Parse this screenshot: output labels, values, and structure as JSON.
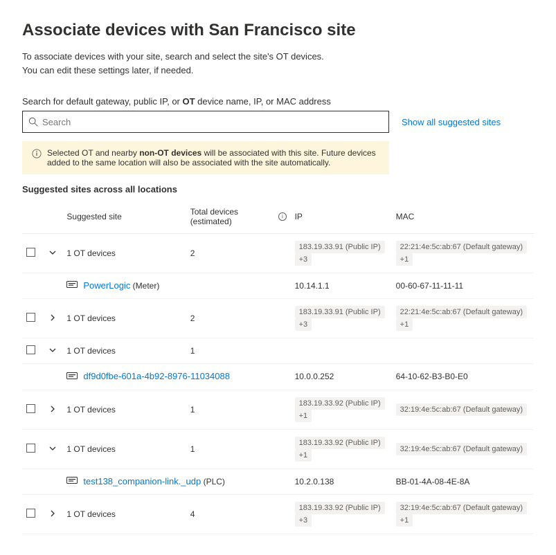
{
  "title": "Associate devices with San Francisco site",
  "desc_line1": "To associate devices with your site, search and select the site's OT devices.",
  "desc_line2": "You can edit these settings later, if needed.",
  "search_label_pre": "Search for default gateway, public IP, or ",
  "search_label_bold": "OT",
  "search_label_post": " device name, IP, or MAC address",
  "search_placeholder": "Search",
  "show_all_link": "Show all suggested sites",
  "banner_pre": "Selected OT and nearby ",
  "banner_bold": "non-OT devices",
  "banner_post": " will be associated with this site. Future devices added to the same location will also be associated with the site automatically.",
  "section_title": "Suggested sites across all locations",
  "columns": {
    "site": "Suggested site",
    "total": "Total devices (estimated)",
    "ip": "IP",
    "mac": "MAC"
  },
  "rows": [
    {
      "type": "group",
      "expanded": true,
      "site": "1 OT devices",
      "total": "2",
      "ip_tag": "183.19.33.91 (Public IP)",
      "ip_cnt": "+3",
      "mac_tag": "22:21:4e:5c:ab:67 (Default gateway)",
      "mac_cnt": "+1"
    },
    {
      "type": "child",
      "name": "PowerLogic",
      "suffix": " (Meter)",
      "ip": "10.14.1.1",
      "mac": "00-60-67-11-11-11"
    },
    {
      "type": "group",
      "expanded": false,
      "site": "1 OT devices",
      "total": "2",
      "ip_tag": "183.19.33.91 (Public IP)",
      "ip_cnt": "+3",
      "mac_tag": "22:21:4e:5c:ab:67 (Default gateway)",
      "mac_cnt": "+1"
    },
    {
      "type": "group",
      "expanded": true,
      "site": "1 OT devices",
      "total": "1",
      "ip_tag": "",
      "ip_cnt": "",
      "mac_tag": "",
      "mac_cnt": ""
    },
    {
      "type": "child",
      "name": "df9d0fbe-601a-4b92-8976-11034088",
      "suffix": "",
      "ip": "10.0.0.252",
      "mac": "64-10-62-B3-B0-E0"
    },
    {
      "type": "group",
      "expanded": false,
      "site": "1 OT devices",
      "total": "1",
      "ip_tag": "183.19.33.92 (Public IP)",
      "ip_cnt": "+1",
      "mac_tag": "32:19:4e:5c:ab:67 (Default gateway)",
      "mac_cnt": ""
    },
    {
      "type": "group",
      "expanded": true,
      "site": "1 OT devices",
      "total": "1",
      "ip_tag": "183.19.33.92 (Public IP)",
      "ip_cnt": "+1",
      "mac_tag": "32:19:4e:5c:ab:67 (Default gateway)",
      "mac_cnt": ""
    },
    {
      "type": "child",
      "name": "test138_companion-link._udp",
      "suffix": " (PLC)",
      "ip": "10.2.0.138",
      "mac": "BB-01-4A-08-4E-8A"
    },
    {
      "type": "group",
      "expanded": false,
      "site": "1 OT devices",
      "total": "4",
      "ip_tag": "183.19.33.92 (Public IP)",
      "ip_cnt": "+3",
      "mac_tag": "32:19:4e:5c:ab:67 (Default gateway)",
      "mac_cnt": "+1"
    }
  ]
}
